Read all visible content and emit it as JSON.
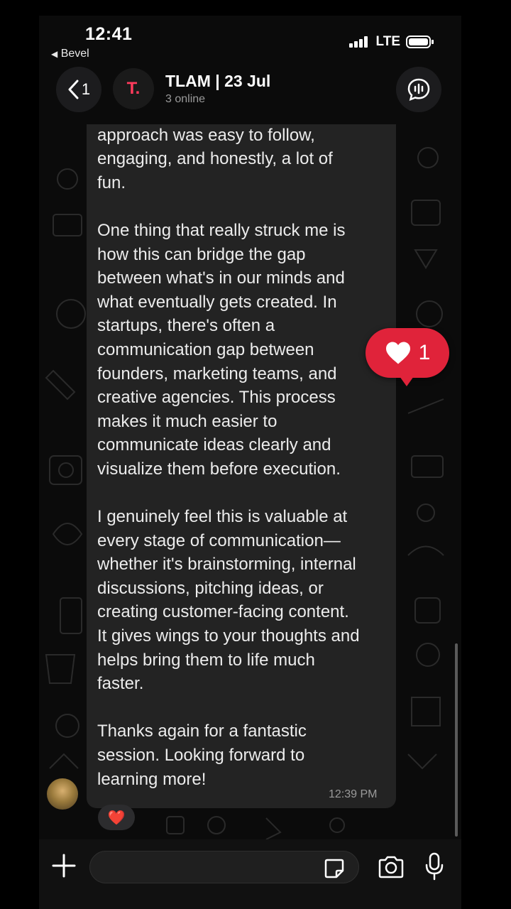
{
  "status_bar": {
    "time": "12:41",
    "back_app": "Bevel",
    "network": "LTE"
  },
  "header": {
    "back_count": "1",
    "title": "TLAM | 23 Jul",
    "subtitle": "3 online",
    "group_avatar_letter": "T."
  },
  "message": {
    "text": "process. Even for a beginner, the\napproach was easy to follow,\nengaging, and honestly, a lot of\nfun.\n\nOne thing that really struck me is\nhow this can bridge the gap\nbetween what's in our minds and\nwhat eventually gets created. In\nstartups, there's often a\ncommunication gap between\nfounders, marketing teams, and\ncreative agencies. This process\nmakes it much easier to\ncommunicate ideas clearly and\nvisualize them before execution.\n\nI genuinely feel this is valuable at\nevery stage of communication—\nwhether it's brainstorming, internal\ndiscussions, pitching ideas, or\ncreating customer-facing content.\nIt gives wings to your thoughts and\nhelps bring them to life much\nfaster.\n\nThanks again for a fantastic\nsession. Looking forward to\nlearning more!",
    "time": "12:39 PM",
    "reaction_emoji": "❤️"
  },
  "heart_badge": {
    "count": "1"
  },
  "input": {
    "value": "",
    "placeholder": ""
  },
  "colors": {
    "accent_red": "#e0233a",
    "bubble": "#232323",
    "background": "#0b0b0b"
  },
  "icons": [
    "back-chevron-icon",
    "voice-chat-icon",
    "plus-icon",
    "sticker-icon",
    "camera-icon",
    "microphone-icon",
    "heart-icon"
  ]
}
